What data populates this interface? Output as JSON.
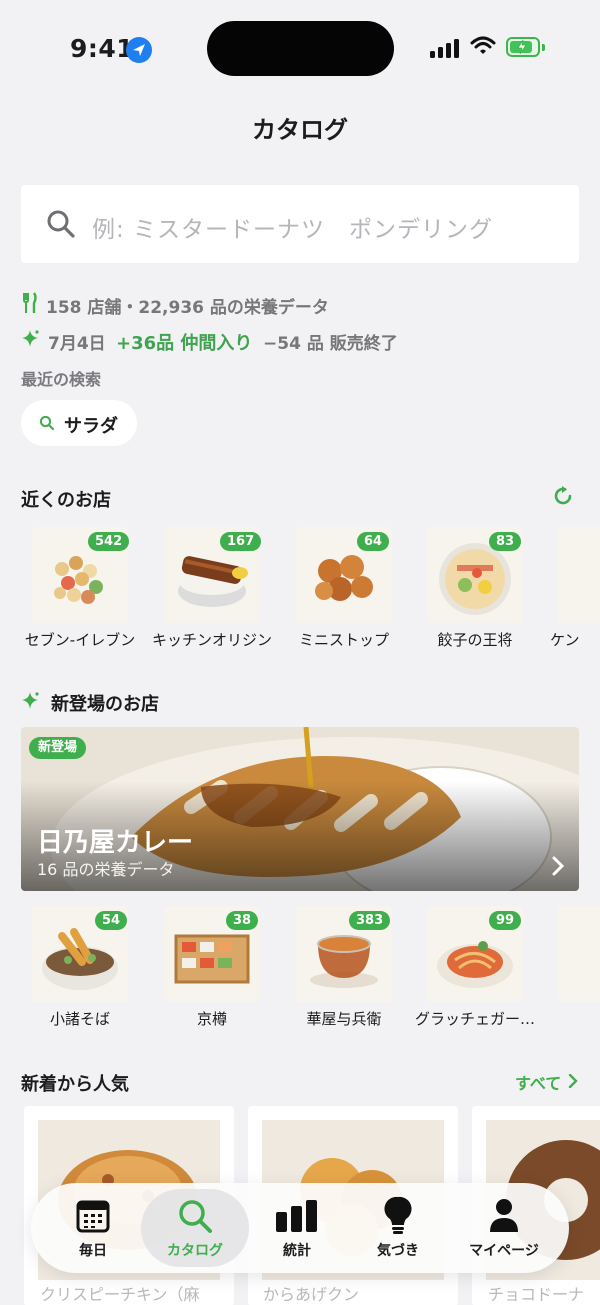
{
  "status_bar": {
    "time": "9:41"
  },
  "page": {
    "title": "カタログ"
  },
  "search": {
    "placeholder": "例: ミスタードーナツ　ポンデリング"
  },
  "stats": {
    "summary": "158 店舗・22,936 品の栄養データ",
    "date": "7月4日",
    "added": "+36品 仲間入り",
    "ended": "−54 品 販売終了"
  },
  "recent": {
    "label": "最近の検索",
    "chip": "サラダ"
  },
  "nearby": {
    "title": "近くのお店",
    "stores": [
      {
        "name": "セブン-イレブン",
        "count": "542"
      },
      {
        "name": "キッチンオリジン",
        "count": "167"
      },
      {
        "name": "ミニストップ",
        "count": "64"
      },
      {
        "name": "餃子の王将",
        "count": "83"
      },
      {
        "name": "ケン",
        "count": ""
      }
    ]
  },
  "new_stores": {
    "title": "新登場のお店",
    "banner": {
      "badge": "新登場",
      "name": "日乃屋カレー",
      "subtitle": "16 品の栄養データ"
    },
    "stores": [
      {
        "name": "小諸そば",
        "count": "54"
      },
      {
        "name": "京樽",
        "count": "38"
      },
      {
        "name": "華屋与兵衛",
        "count": "383"
      },
      {
        "name": "グラッチェガー…",
        "count": "99"
      }
    ]
  },
  "popular": {
    "title": "新着から人気",
    "see_all": "すべて",
    "items": [
      {
        "name": "クリスピーチキン（麻"
      },
      {
        "name": "からあげクン"
      },
      {
        "name": "チョコドーナ"
      }
    ]
  },
  "tabbar": {
    "tabs": [
      {
        "label": "毎日",
        "icon": "calendar-icon"
      },
      {
        "label": "カタログ",
        "icon": "search-icon",
        "active": true
      },
      {
        "label": "統計",
        "icon": "bar-chart-icon"
      },
      {
        "label": "気づき",
        "icon": "lightbulb-icon"
      },
      {
        "label": "マイページ",
        "icon": "person-icon"
      }
    ]
  },
  "colors": {
    "accent": "#3fae4c",
    "background": "#f2f2f5",
    "location": "#1f7ff0"
  }
}
